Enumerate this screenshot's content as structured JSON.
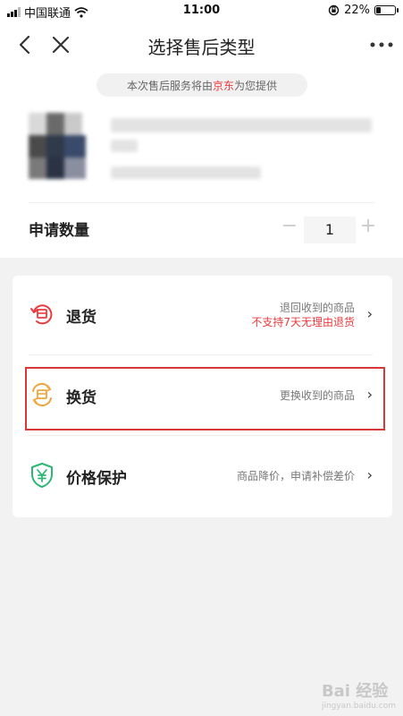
{
  "status_bar": {
    "carrier": "中国联通",
    "time": "11:00",
    "battery": "22%",
    "battery_level": 0.22
  },
  "nav": {
    "title": "选择售后类型"
  },
  "notice": {
    "prefix": "本次售后服务将由",
    "brand": "京东",
    "suffix": "为您提供",
    "brand_color": "#e93b3d"
  },
  "quantity": {
    "label": "申请数量",
    "minus": "−",
    "value": "1",
    "plus": "+"
  },
  "options": [
    {
      "icon": "return-icon",
      "title": "退货",
      "desc": "退回收到的商品",
      "warning": "不支持7天无理由退货",
      "chevron": "›"
    },
    {
      "icon": "exchange-icon",
      "title": "换货",
      "desc": "更换收到的商品",
      "chevron": "›",
      "highlighted": true
    },
    {
      "icon": "price-protect-icon",
      "title": "价格保护",
      "desc": "商品降价，申请补偿差价",
      "chevron": "›"
    }
  ],
  "watermark": {
    "brand": "Bai 经验",
    "url": "jingyan.baidu.com"
  },
  "colors": {
    "accent_red": "#e93b3d",
    "exchange_orange": "#f0a43c",
    "price_green": "#2bb673",
    "highlight_border": "#d9383a"
  }
}
